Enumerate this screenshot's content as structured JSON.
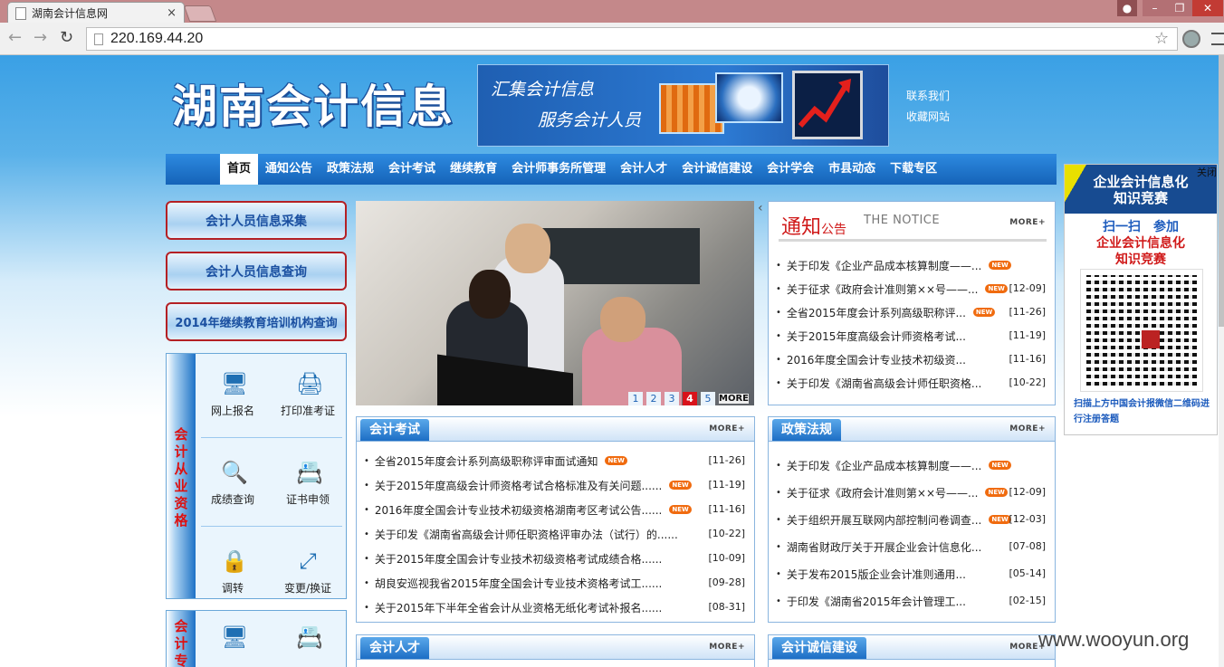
{
  "browser": {
    "tab_title": "湖南会计信息网",
    "url": "220.169.44.20"
  },
  "header": {
    "logo": "湖南会计信息",
    "banner_line1": "汇集会计信息",
    "banner_line2": "服务会计人员",
    "links": [
      "联系我们",
      "收藏网站"
    ]
  },
  "nav": [
    "首页",
    "通知公告",
    "政策法规",
    "会计考试",
    "继续教育",
    "会计师事务所管理",
    "会计人才",
    "会计诚信建设",
    "会计学会",
    "市县动态",
    "下载专区"
  ],
  "left": {
    "buttons": [
      "会计人员信息采集",
      "会计人员信息查询",
      "2014年继续教育培训机构查询"
    ],
    "qual_title": "会计从业资格",
    "qual_items": [
      "网上报名",
      "打印准考证",
      "成绩查询",
      "证书申领",
      "调转",
      "变更/换证"
    ],
    "qual2_title": "会计专业"
  },
  "slider": {
    "pages": [
      "1",
      "2",
      "3",
      "4",
      "5"
    ],
    "active": "4",
    "more": "MORE"
  },
  "notice": {
    "title": "通知",
    "title_small": "公告",
    "en": "THE NOTICE",
    "more": "MORE+",
    "items": [
      {
        "t": "关于印发《企业产品成本核算制度——...",
        "d": "",
        "new": true
      },
      {
        "t": "关于征求《政府会计准则第××号——...",
        "d": "[12-09]",
        "new": true
      },
      {
        "t": "全省2015年度会计系列高级职称评...",
        "d": "[11-26]",
        "new": true
      },
      {
        "t": "关于2015年度高级会计师资格考试...",
        "d": "[11-19]",
        "new": false
      },
      {
        "t": "2016年度全国会计专业技术初级资...",
        "d": "[11-16]",
        "new": false
      },
      {
        "t": "关于印发《湖南省高级会计师任职资格...",
        "d": "[10-22]",
        "new": false
      }
    ]
  },
  "exam": {
    "title": "会计考试",
    "more": "MORE+",
    "items": [
      {
        "t": "全省2015年度会计系列高级职称评审面试通知",
        "d": "[11-26]",
        "new": true
      },
      {
        "t": "关于2015年度高级会计师资格考试合格标准及有关问题......",
        "d": "[11-19]",
        "new": true
      },
      {
        "t": "2016年度全国会计专业技术初级资格湖南考区考试公告......",
        "d": "[11-16]",
        "new": true
      },
      {
        "t": "关于印发《湖南省高级会计师任职资格评审办法（试行）的......",
        "d": "[10-22]",
        "new": false
      },
      {
        "t": "关于2015年度全国会计专业技术初级资格考试成绩合格......",
        "d": "[10-09]",
        "new": false
      },
      {
        "t": "胡良安巡视我省2015年度全国会计专业技术资格考试工......",
        "d": "[09-28]",
        "new": false
      },
      {
        "t": "关于2015年下半年全省会计从业资格无纸化考试补报名......",
        "d": "[08-31]",
        "new": false
      }
    ]
  },
  "policy": {
    "title": "政策法规",
    "more": "MORE+",
    "items": [
      {
        "t": "关于印发《企业产品成本核算制度——...",
        "d": "",
        "new": true
      },
      {
        "t": "关于征求《政府会计准则第××号——...",
        "d": "[12-09]",
        "new": true
      },
      {
        "t": "关于组织开展互联网内部控制问卷调查...",
        "d": "[12-03]",
        "new": true
      },
      {
        "t": "湖南省财政厅关于开展企业会计信息化...",
        "d": "[07-08]",
        "new": false
      },
      {
        "t": "关于发布2015版企业会计准则通用...",
        "d": "[05-14]",
        "new": false
      },
      {
        "t": "于印发《湖南省2015年会计管理工...",
        "d": "[02-15]",
        "new": false
      }
    ]
  },
  "talent": {
    "title": "会计人才",
    "more": "MORE+"
  },
  "integrity": {
    "title": "会计诚信建设",
    "more": "MORE+"
  },
  "ad": {
    "top": "企业会计信息化\n知识竞赛",
    "scan": "扫一扫　参加",
    "red": "企业会计信息化\n知识竞赛",
    "foot": "扫描上方中国会计报微信二维码进行注册答题",
    "close": "关闭"
  },
  "watermark": "www.wooyun.org"
}
